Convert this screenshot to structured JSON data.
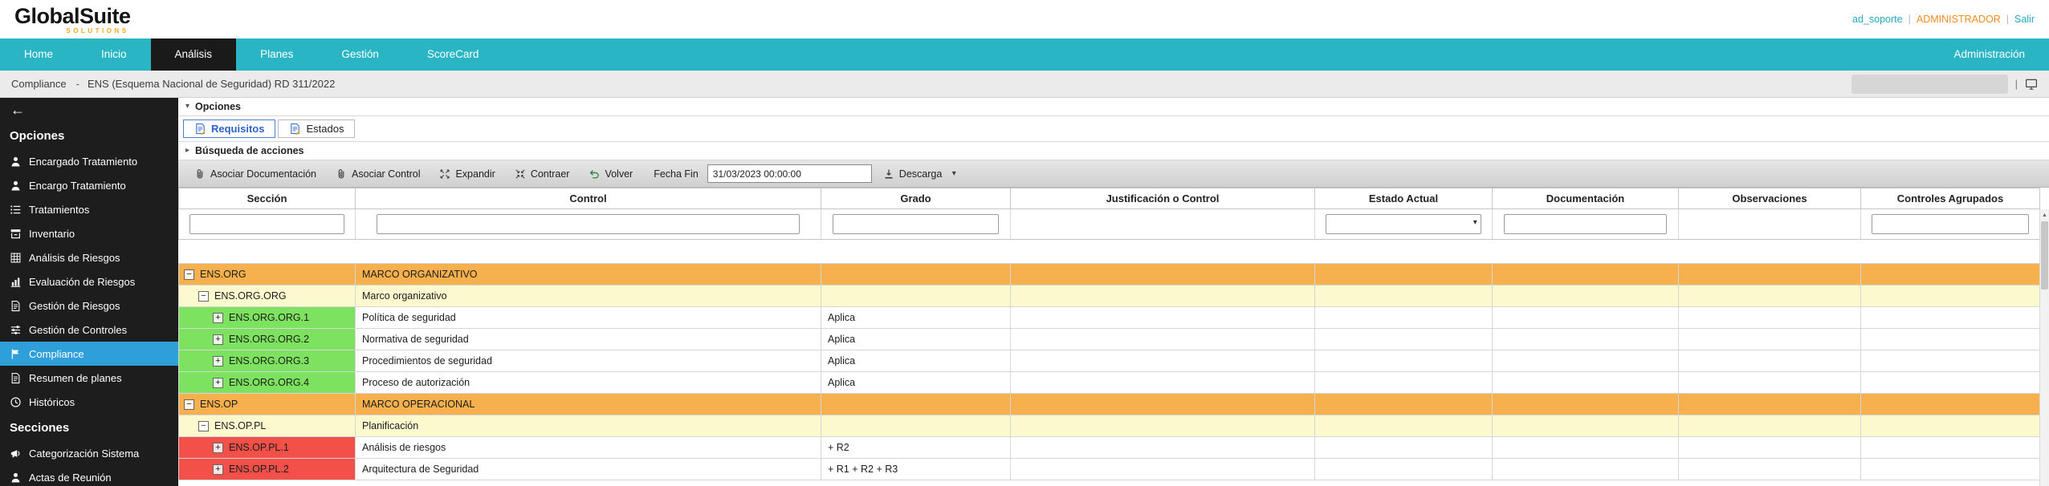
{
  "header": {
    "logo_main": "GlobalSuite",
    "logo_sub": "SOLUTIONS",
    "user": "ad_soporte",
    "sep1": "|",
    "role": "ADMINISTRADOR",
    "sep2": "|",
    "logout": "Salir"
  },
  "nav": {
    "items": [
      {
        "label": "Home",
        "active": false
      },
      {
        "label": "Inicio",
        "active": false
      },
      {
        "label": "Análisis",
        "active": true
      },
      {
        "label": "Planes",
        "active": false
      },
      {
        "label": "Gestión",
        "active": false
      },
      {
        "label": "ScoreCard",
        "active": false
      }
    ],
    "right": {
      "label": "Administración"
    }
  },
  "breadcrumb": {
    "module": "Compliance",
    "separator": "-",
    "path": "ENS (Esquema Nacional de Seguridad) RD 311/2022",
    "right_separator": "|"
  },
  "sidebar": {
    "back_icon": "←",
    "sections": [
      {
        "title": "Opciones",
        "items": [
          {
            "label": "Encargado Tratamiento",
            "icon": "person-icon",
            "selected": false
          },
          {
            "label": "Encargo Tratamiento",
            "icon": "person-icon",
            "selected": false
          },
          {
            "label": "Tratamientos",
            "icon": "list-icon",
            "selected": false
          },
          {
            "label": "Inventario",
            "icon": "archive-icon",
            "selected": false
          },
          {
            "label": "Análisis de Riesgos",
            "icon": "grid-icon",
            "selected": false
          },
          {
            "label": "Evaluación de Riesgos",
            "icon": "bar-chart-icon",
            "selected": false
          },
          {
            "label": "Gestión de Riesgos",
            "icon": "document-icon",
            "selected": false
          },
          {
            "label": "Gestión de Controles",
            "icon": "sliders-icon",
            "selected": false
          },
          {
            "label": "Compliance",
            "icon": "flag-icon",
            "selected": true
          },
          {
            "label": "Resumen de planes",
            "icon": "document-icon",
            "selected": false
          },
          {
            "label": "Históricos",
            "icon": "clock-icon",
            "selected": false
          }
        ]
      },
      {
        "title": "Secciones",
        "items": [
          {
            "label": "Categorización Sistema",
            "icon": "megaphone-icon",
            "selected": false
          },
          {
            "label": "Actas de Reunión",
            "icon": "person-icon",
            "selected": false
          }
        ]
      }
    ]
  },
  "content": {
    "options_header": {
      "label": "Opciones",
      "icon": "triangle-down-icon"
    },
    "tabs": [
      {
        "label": "Requisitos",
        "icon": "document-edit-icon",
        "active": true
      },
      {
        "label": "Estados",
        "icon": "document-edit-icon",
        "active": false
      }
    ],
    "search_header": {
      "label": "Búsqueda de acciones",
      "icon": "triangle-right-icon"
    },
    "toolbar": {
      "buttons": [
        {
          "label": "Asociar Documentación",
          "icon": "paperclip-icon"
        },
        {
          "label": "Asociar Control",
          "icon": "paperclip-icon"
        },
        {
          "label": "Expandir",
          "icon": "expand-icon"
        },
        {
          "label": "Contraer",
          "icon": "collapse-icon"
        },
        {
          "label": "Volver",
          "icon": "undo-arrow-icon"
        }
      ],
      "date_label": "Fecha Fin",
      "date_value": "31/03/2023 00:00:00",
      "download": {
        "label": "Descarga",
        "icon": "download-icon",
        "caret_icon": "caret-down-icon"
      }
    },
    "table": {
      "columns": [
        "Sección",
        "Control",
        "Grado",
        "Justificación o Control",
        "Estado Actual",
        "Documentación",
        "Observaciones",
        "Controles Agrupados"
      ],
      "filters": [
        "input",
        "input",
        "input",
        "none",
        "select",
        "input",
        "none",
        "input"
      ],
      "rows": [
        {
          "section": "ENS.ORG",
          "control": "MARCO ORGANIZATIVO",
          "grado": "",
          "level": 0,
          "style": "orange",
          "toggle": "−"
        },
        {
          "section": "ENS.ORG.ORG",
          "control": "Marco organizativo",
          "grado": "",
          "level": 1,
          "style": "yellow",
          "toggle": "−"
        },
        {
          "section": "ENS.ORG.ORG.1",
          "control": "Política de seguridad",
          "grado": "Aplica",
          "level": 2,
          "style": "green",
          "toggle": "+"
        },
        {
          "section": "ENS.ORG.ORG.2",
          "control": "Normativa de seguridad",
          "grado": "Aplica",
          "level": 2,
          "style": "green",
          "toggle": "+"
        },
        {
          "section": "ENS.ORG.ORG.3",
          "control": "Procedimientos de seguridad",
          "grado": "Aplica",
          "level": 2,
          "style": "green",
          "toggle": "+"
        },
        {
          "section": "ENS.ORG.ORG.4",
          "control": "Proceso de autorización",
          "grado": "Aplica",
          "level": 2,
          "style": "green",
          "toggle": "+"
        },
        {
          "section": "ENS.OP",
          "control": "MARCO OPERACIONAL",
          "grado": "",
          "level": 0,
          "style": "orange",
          "toggle": "−"
        },
        {
          "section": "ENS.OP.PL",
          "control": "Planificación",
          "grado": "",
          "level": 1,
          "style": "yellow",
          "toggle": "−"
        },
        {
          "section": "ENS.OP.PL.1",
          "control": "Análisis de riesgos",
          "grado": "+ R2",
          "level": 2,
          "style": "red",
          "toggle": "+"
        },
        {
          "section": "ENS.OP.PL.2",
          "control": "Arquitectura de Seguridad",
          "grado": "+ R1 + R2 + R3",
          "level": 2,
          "style": "red",
          "toggle": "+"
        }
      ]
    }
  },
  "colors": {
    "nav_teal": "#2ab5c5",
    "nav_active": "#1a1a1a",
    "sidebar_bg": "#1d1d1d",
    "sidebar_selected": "#2e9fd9",
    "row_orange": "#f6b14e",
    "row_yellow": "#fcf9cf",
    "cell_green": "#7de25f",
    "cell_red": "#f3504a",
    "accent_orange": "#ef8d21",
    "accent_cyan": "#2aa9bd",
    "tab_active_blue": "#2b62c9",
    "logo_sub_yellow": "#f2a71b"
  }
}
